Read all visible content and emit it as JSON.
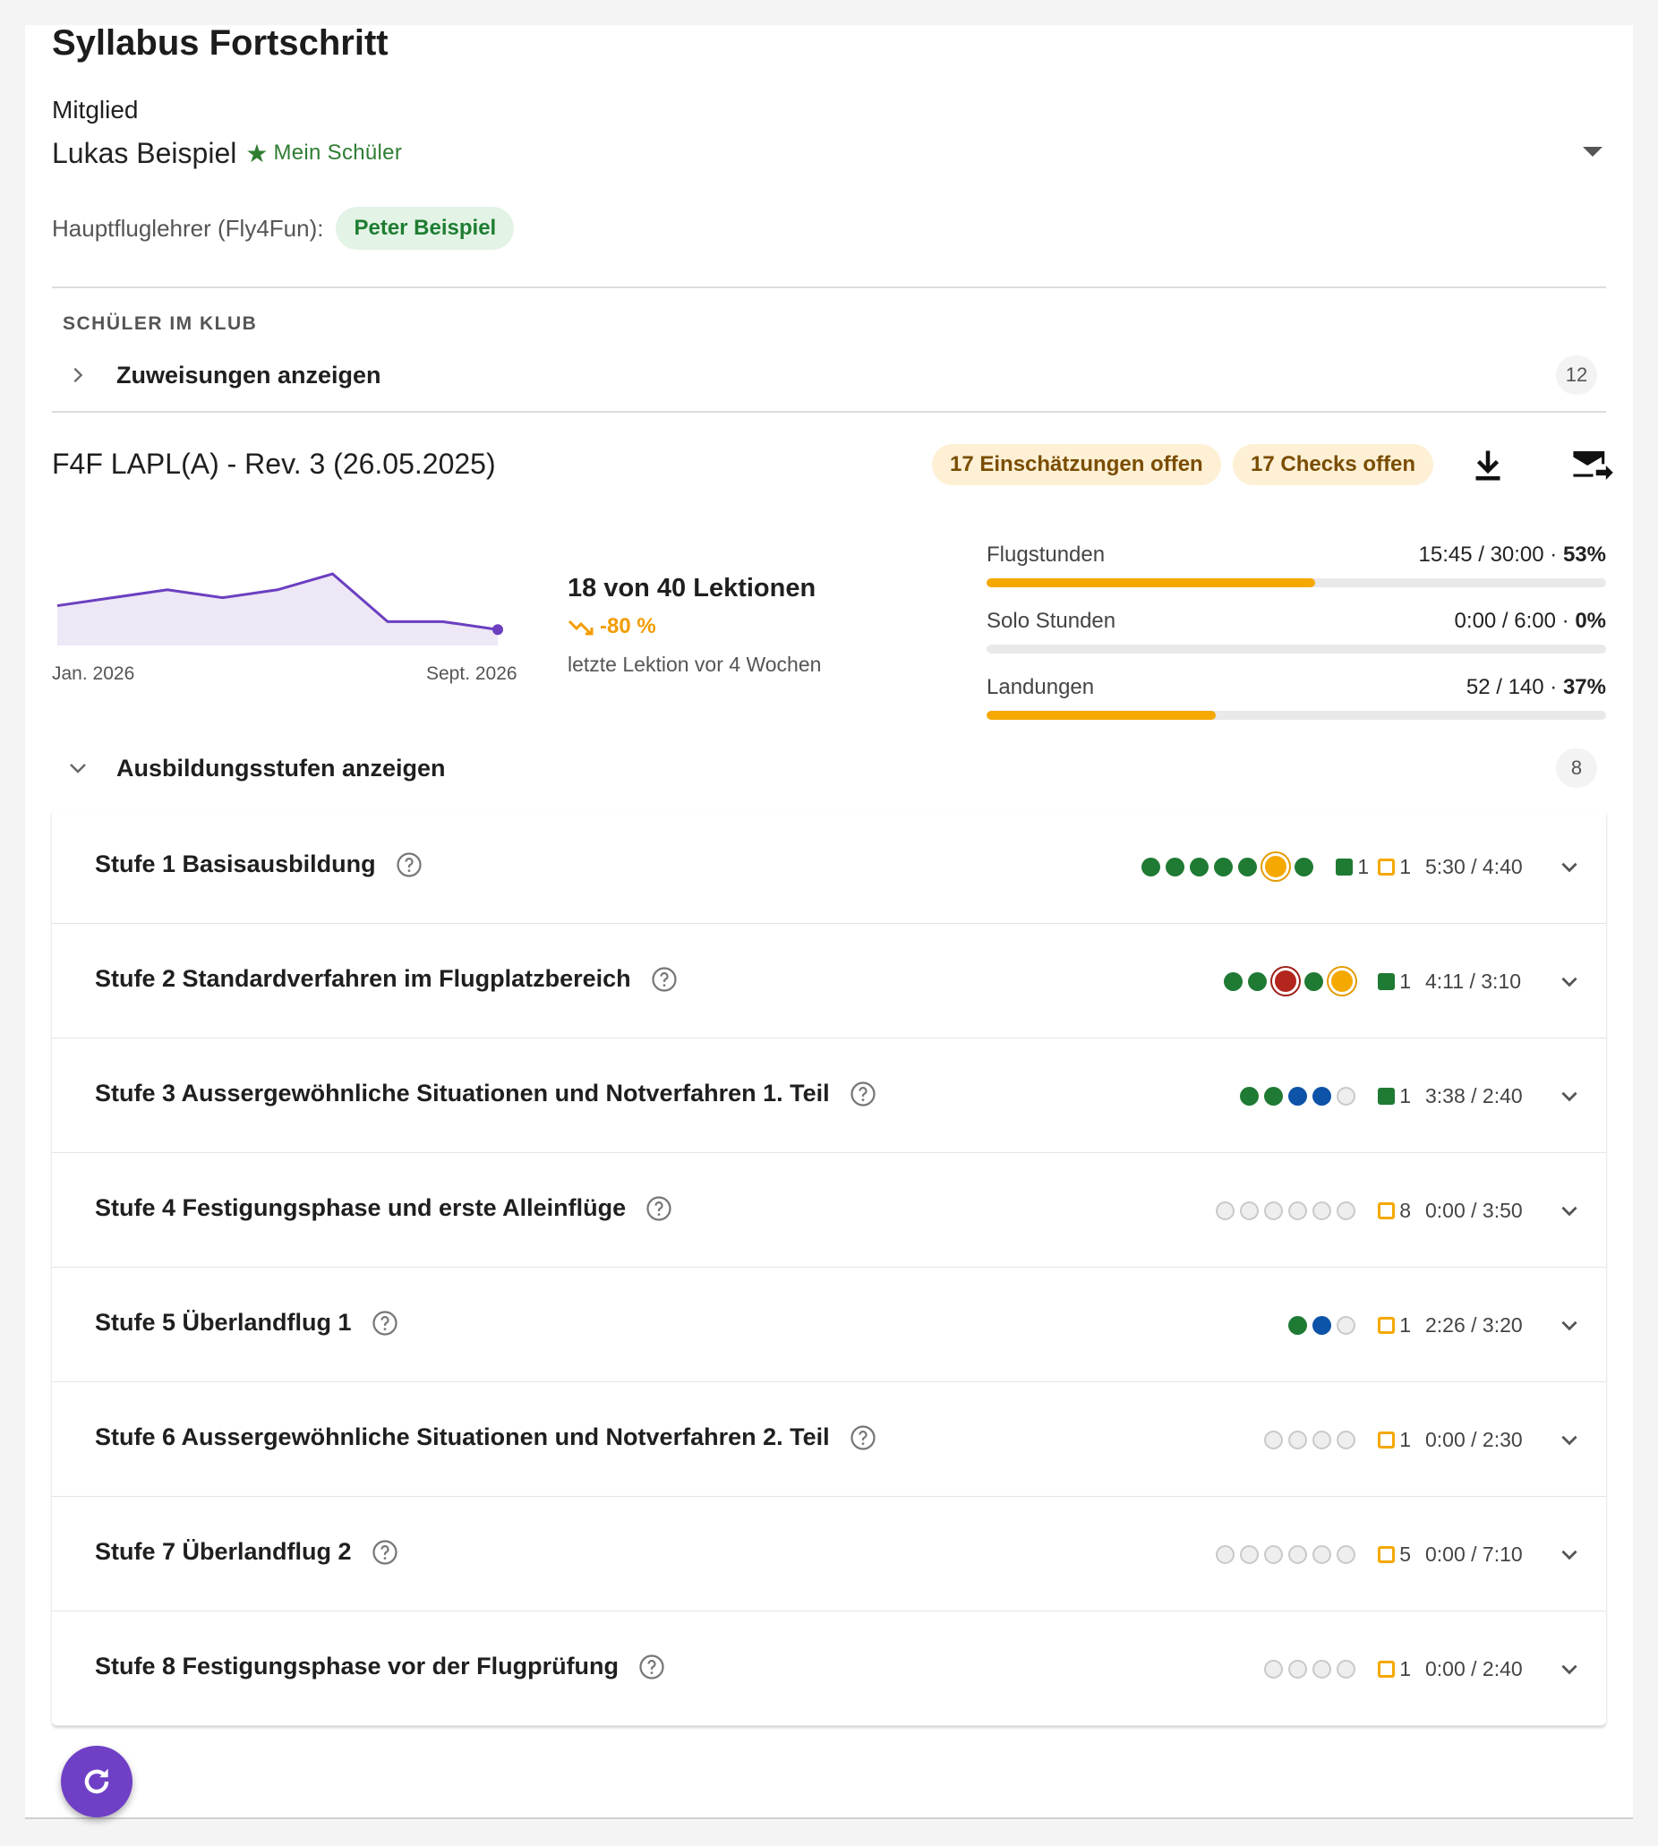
{
  "header": {
    "title": "Syllabus Fortschritt"
  },
  "member": {
    "label": "Mitglied",
    "name": "Lukas Beispiel",
    "star_icon": "★",
    "tag": "Mein Schüler"
  },
  "instructor": {
    "label": "Hauptfluglehrer (Fly4Fun):",
    "name": "Peter Beispiel"
  },
  "club": {
    "section_label": "SCHÜLER IM KLUB",
    "expander_label": "Zuweisungen anzeigen",
    "count": "12"
  },
  "program": {
    "title": "F4F LAPL(A) - Rev. 3 (26.05.2025)",
    "assessments_open": "17 Einschätzungen offen",
    "checks_open": "17 Checks offen",
    "download_icon": "download-icon",
    "email_icon": "email-forward-icon"
  },
  "trend": {
    "x_start_label": "Jan. 2026",
    "x_end_label": "Sept. 2026",
    "values": [
      5,
      6,
      7,
      6,
      7,
      9,
      3,
      3,
      2
    ],
    "lessons_summary": "18 von 40 Lektionen",
    "change": "-80 %",
    "last_lesson": "letzte Lektion vor 4 Wochen",
    "color": "#6b3fc0"
  },
  "stats": [
    {
      "name": "Flugstunden",
      "value": "15:45 / 30:00 · ",
      "percent": "53%",
      "fill": 0.53
    },
    {
      "name": "Solo Stunden",
      "value": "0:00 / 6:00 · ",
      "percent": "0%",
      "fill": 0.0
    },
    {
      "name": "Landungen",
      "value": "52 / 140 · ",
      "percent": "37%",
      "fill": 0.37
    }
  ],
  "stages_section": {
    "expander_label": "Ausbildungsstufen anzeigen",
    "count": "8"
  },
  "stages": [
    {
      "title": "Stufe 1 Basisausbildung",
      "dots": [
        "g",
        "g",
        "g",
        "g",
        "g",
        "o",
        "g"
      ],
      "marks": [
        {
          "kind": "g",
          "count": "1"
        },
        {
          "kind": "o",
          "count": "1"
        }
      ],
      "time": "5:30 / 4:40"
    },
    {
      "title": "Stufe 2 Standardverfahren im Flugplatzbereich",
      "dots": [
        "g",
        "g",
        "r",
        "g",
        "o"
      ],
      "marks": [
        {
          "kind": "g",
          "count": "1"
        }
      ],
      "time": "4:11 / 3:10"
    },
    {
      "title": "Stufe 3 Aussergewöhnliche Situationen und Notverfahren 1. Teil",
      "dots": [
        "g",
        "g",
        "b",
        "b",
        "e"
      ],
      "marks": [
        {
          "kind": "g",
          "count": "1"
        }
      ],
      "time": "3:38 / 2:40"
    },
    {
      "title": "Stufe 4 Festigungsphase und erste Alleinflüge",
      "dots": [
        "e",
        "e",
        "e",
        "e",
        "e",
        "e"
      ],
      "marks": [
        {
          "kind": "o",
          "count": "8"
        }
      ],
      "time": "0:00 / 3:50"
    },
    {
      "title": "Stufe 5 Überlandflug 1",
      "dots": [
        "g",
        "b",
        "e"
      ],
      "marks": [
        {
          "kind": "o",
          "count": "1"
        }
      ],
      "time": "2:26 / 3:20"
    },
    {
      "title": "Stufe 6 Aussergewöhnliche Situationen und Notverfahren 2. Teil",
      "dots": [
        "e",
        "e",
        "e",
        "e"
      ],
      "marks": [
        {
          "kind": "o",
          "count": "1"
        }
      ],
      "time": "0:00 / 2:30"
    },
    {
      "title": "Stufe 7 Überlandflug 2",
      "dots": [
        "e",
        "e",
        "e",
        "e",
        "e",
        "e"
      ],
      "marks": [
        {
          "kind": "o",
          "count": "5"
        }
      ],
      "time": "0:00 / 7:10"
    },
    {
      "title": "Stufe 8 Festigungsphase vor der Flugprüfung",
      "dots": [
        "e",
        "e",
        "e",
        "e"
      ],
      "marks": [
        {
          "kind": "o",
          "count": "1"
        }
      ],
      "time": "0:00 / 2:40"
    }
  ],
  "fab": {
    "icon": "refresh-icon"
  }
}
